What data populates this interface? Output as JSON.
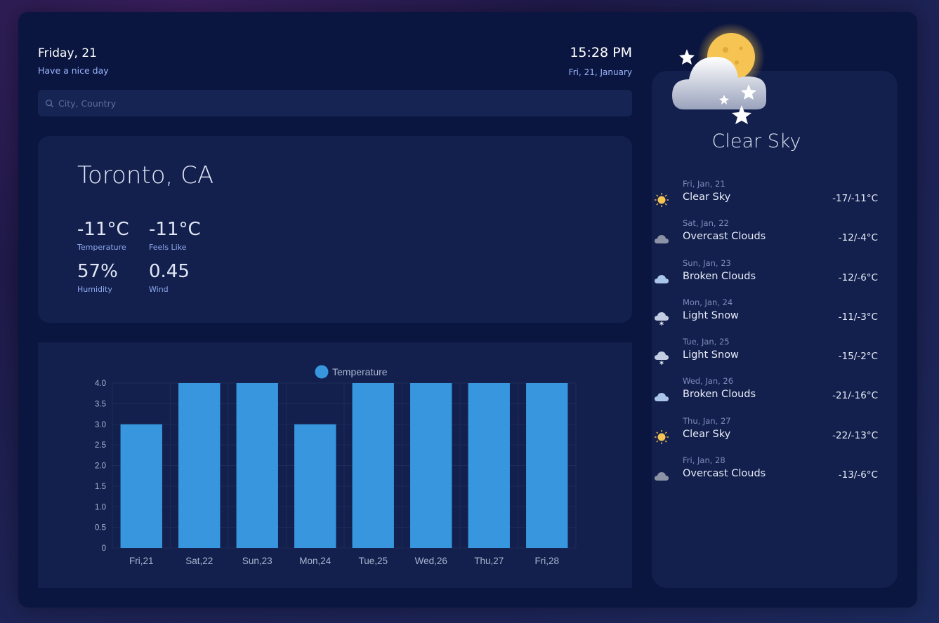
{
  "header": {
    "day": "Friday, 21",
    "greeting": "Have a nice day",
    "time": "15:28 PM",
    "date": "Fri, 21, January"
  },
  "search": {
    "placeholder": "City, Country",
    "value": ""
  },
  "current": {
    "city": "Toronto, CA",
    "temperature": {
      "value": "-11°C",
      "label": "Temperature"
    },
    "feels_like": {
      "value": "-11°C",
      "label": "Feels Like"
    },
    "humidity": {
      "value": "57%",
      "label": "Humidity"
    },
    "wind": {
      "value": "0.45",
      "label": "Wind"
    }
  },
  "hero": {
    "condition": "Clear Sky",
    "icon": "moon-cloud-stars-icon"
  },
  "forecast": [
    {
      "date": "Fri, Jan, 21",
      "desc": "Clear Sky",
      "temp": "-17/-11°C",
      "icon": "sun"
    },
    {
      "date": "Sat, Jan, 22",
      "desc": "Overcast Clouds",
      "temp": "-12/-4°C",
      "icon": "overcast"
    },
    {
      "date": "Sun, Jan, 23",
      "desc": "Broken Clouds",
      "temp": "-12/-6°C",
      "icon": "broken"
    },
    {
      "date": "Mon, Jan, 24",
      "desc": "Light Snow",
      "temp": "-11/-3°C",
      "icon": "snow"
    },
    {
      "date": "Tue, Jan, 25",
      "desc": "Light Snow",
      "temp": "-15/-2°C",
      "icon": "snow"
    },
    {
      "date": "Wed, Jan, 26",
      "desc": "Broken Clouds",
      "temp": "-21/-16°C",
      "icon": "broken"
    },
    {
      "date": "Thu, Jan, 27",
      "desc": "Clear Sky",
      "temp": "-22/-13°C",
      "icon": "sun"
    },
    {
      "date": "Fri, Jan, 28",
      "desc": "Overcast Clouds",
      "temp": "-13/-6°C",
      "icon": "overcast"
    }
  ],
  "colors": {
    "bar": "#3796dd",
    "accent_text": "#9db6ff"
  },
  "chart_data": {
    "type": "bar",
    "categories": [
      "Fri,21",
      "Sat,22",
      "Sun,23",
      "Mon,24",
      "Tue,25",
      "Wed,26",
      "Thu,27",
      "Fri,28"
    ],
    "series": [
      {
        "name": "Temperature",
        "values": [
          3,
          4,
          4,
          3,
          4,
          4,
          4,
          4
        ]
      }
    ],
    "ylim": [
      0,
      4.0
    ],
    "yticks": [
      "0",
      "0.5",
      "1.0",
      "1.5",
      "2.0",
      "2.5",
      "3.0",
      "3.5",
      "4.0"
    ],
    "legend": "top",
    "grid": true
  }
}
